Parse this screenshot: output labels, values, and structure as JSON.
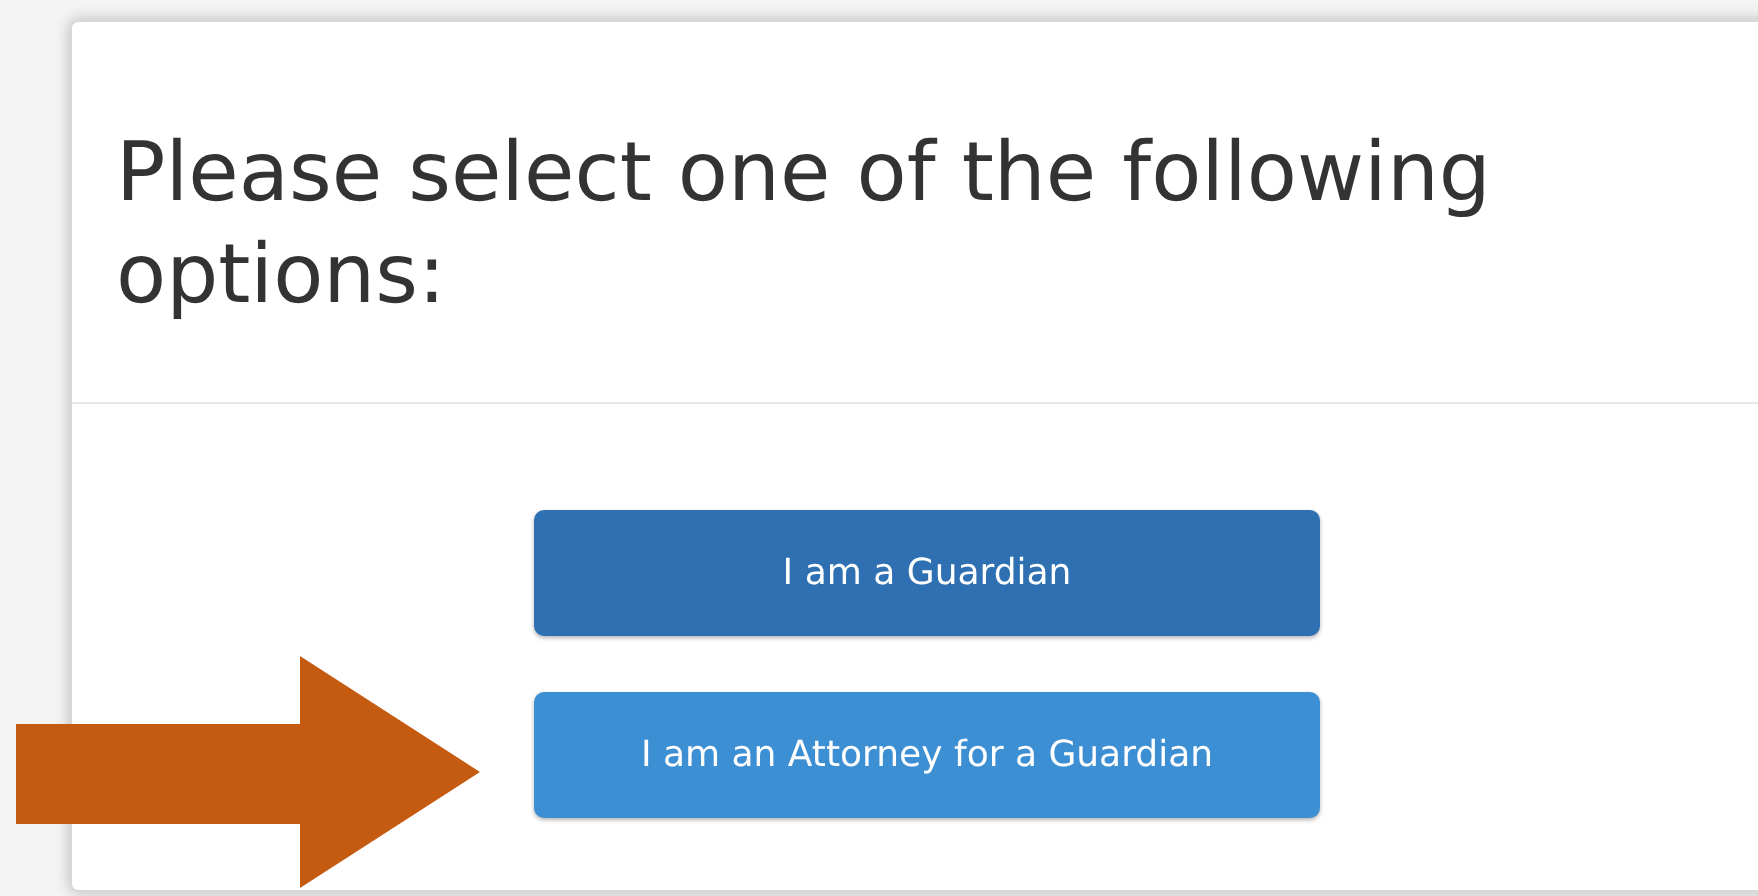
{
  "dialog": {
    "title": "Please select one of the following options:"
  },
  "options": [
    {
      "label": "I am a Guardian",
      "highlighted": false
    },
    {
      "label": "I am an Attorney for a Guardian",
      "highlighted": true
    }
  ],
  "annotation": {
    "kind": "arrow"
  }
}
